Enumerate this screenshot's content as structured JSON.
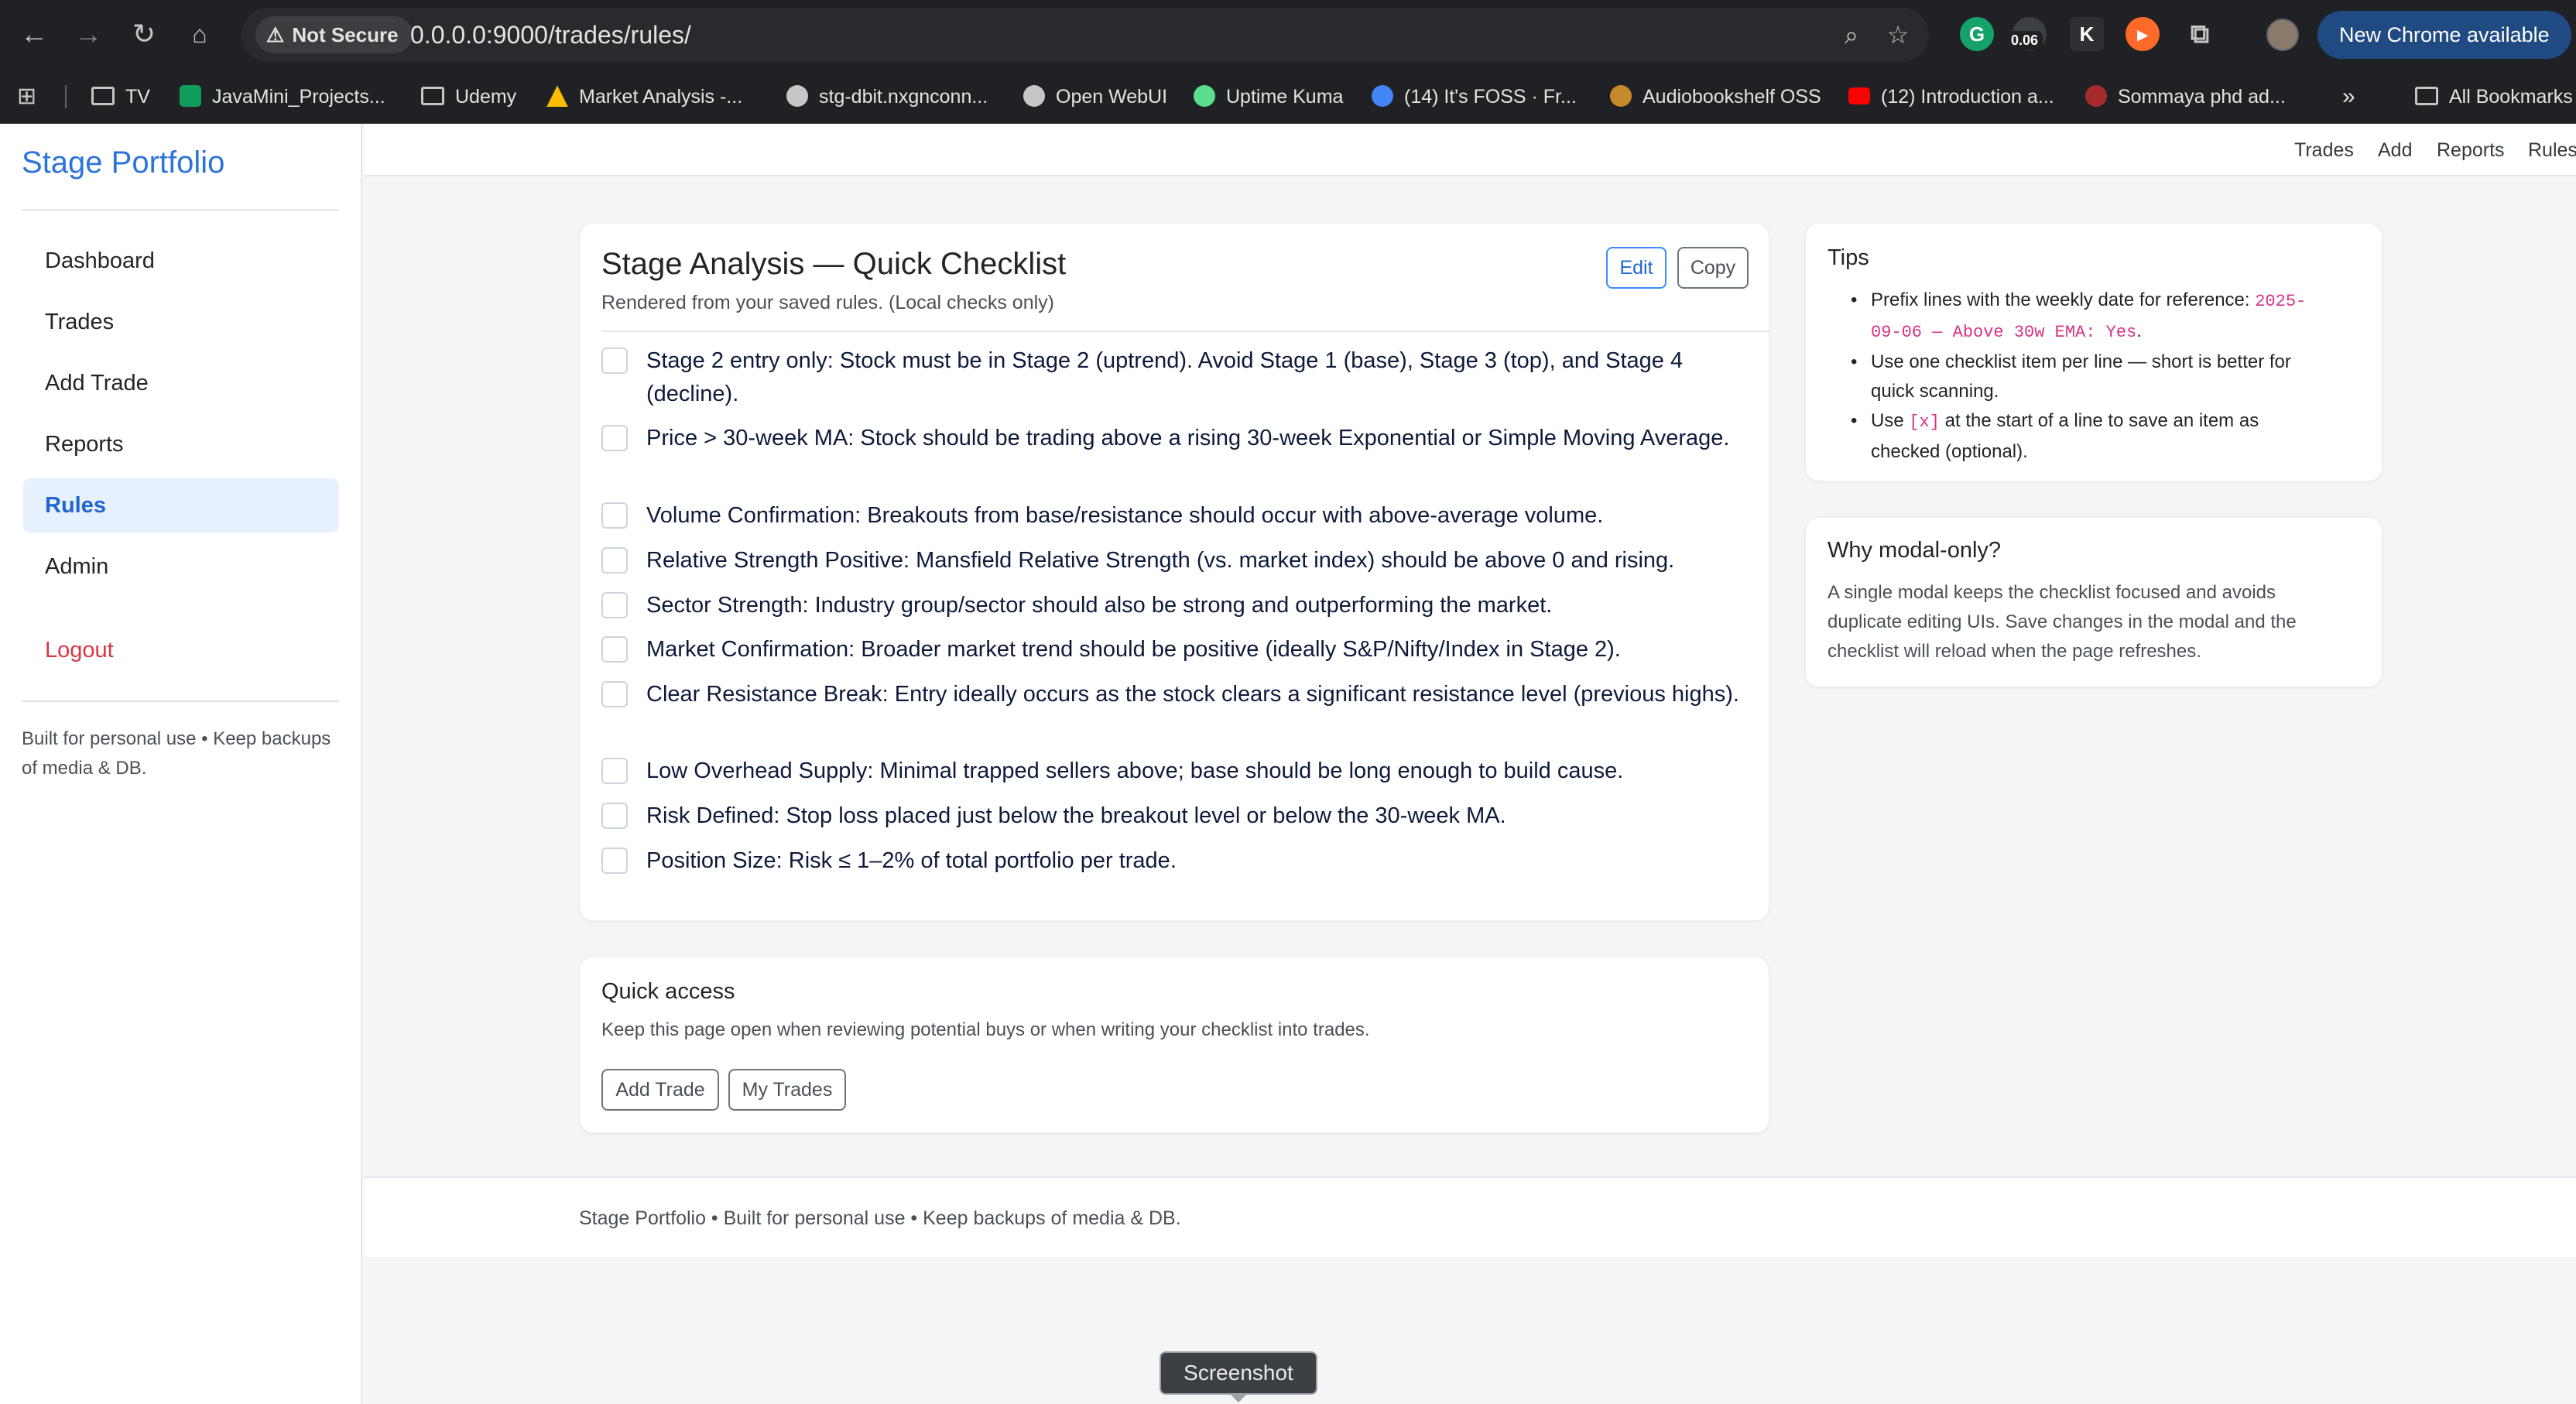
{
  "browser": {
    "not_secure": "Not Secure",
    "warning_icon": "warning-triangle-icon",
    "url": "0.0.0.0:9000/trades/rules/",
    "extension_badge": "0.06",
    "update_button": "New Chrome available",
    "bookmarks": [
      {
        "label": "TV",
        "icon": "folder-icon"
      },
      {
        "label": "JavaMini_Projects...",
        "icon": "sheets-icon",
        "color": "#0f9d58"
      },
      {
        "label": "Udemy",
        "icon": "folder-icon"
      },
      {
        "label": "Market Analysis -...",
        "icon": "drive-icon",
        "color": "#fbbc04"
      },
      {
        "label": "stg-dbit.nxgnconn...",
        "icon": "globe-icon",
        "color": "#c4c7c5"
      },
      {
        "label": "Open WebUI",
        "icon": "globe-icon",
        "color": "#c4c7c5"
      },
      {
        "label": "Uptime Kuma",
        "icon": "uptime-icon",
        "color": "#5cdd8b"
      },
      {
        "label": "(14) It's FOSS · Fr...",
        "icon": "foss-icon",
        "color": "#4285f4"
      },
      {
        "label": "Audiobookshelf OSS",
        "icon": "audiobook-icon",
        "color": "#c58a2c"
      },
      {
        "label": "(12) Introduction a...",
        "icon": "youtube-icon",
        "color": "#ff0000"
      },
      {
        "label": "Sommaya phd ad...",
        "icon": "site-icon",
        "color": "#a52a2a"
      },
      {
        "label": "All Bookmarks",
        "icon": "folder-icon"
      }
    ]
  },
  "sidebar": {
    "brand": "Stage Portfolio",
    "items": [
      {
        "label": "Dashboard"
      },
      {
        "label": "Trades"
      },
      {
        "label": "Add Trade"
      },
      {
        "label": "Reports"
      },
      {
        "label": "Rules"
      },
      {
        "label": "Admin"
      }
    ],
    "logout": "Logout",
    "note": "Built for personal use • Keep backups of media & DB."
  },
  "topnav": [
    "Trades",
    "Add",
    "Reports",
    "Rules"
  ],
  "checklist": {
    "title": "Stage Analysis — Quick Checklist",
    "subtitle": "Rendered from your saved rules. (Local checks only)",
    "edit": "Edit",
    "copy": "Copy",
    "items": [
      {
        "text": "Stage 2 entry only: Stock must be in Stage 2 (uptrend). Avoid Stage 1 (base), Stage 3 (top), and Stage 4 (decline).",
        "checked": false
      },
      {
        "text": "Price > 30-week MA: Stock should be trading above a rising 30-week Exponential or Simple Moving Average.",
        "checked": false
      },
      {
        "text": "Volume Confirmation: Breakouts from base/resistance should occur with above-average volume.",
        "checked": false
      },
      {
        "text": "Relative Strength Positive: Mansfield Relative Strength (vs. market index) should be above 0 and rising.",
        "checked": false
      },
      {
        "text": "Sector Strength: Industry group/sector should also be strong and outperforming the market.",
        "checked": false
      },
      {
        "text": "Market Confirmation: Broader market trend should be positive (ideally S&P/Nifty/Index in Stage 2).",
        "checked": false
      },
      {
        "text": "Clear Resistance Break: Entry ideally occurs as the stock clears a significant resistance level (previous highs).",
        "checked": false
      },
      {
        "text": "Low Overhead Supply: Minimal trapped sellers above; base should be long enough to build cause.",
        "checked": false
      },
      {
        "text": "Risk Defined: Stop loss placed just below the breakout level or below the 30-week MA.",
        "checked": false
      },
      {
        "text": "Position Size: Risk ≤ 1–2% of total portfolio per trade.",
        "checked": false
      }
    ]
  },
  "quick_access": {
    "title": "Quick access",
    "desc": "Keep this page open when reviewing potential buys or when writing your checklist into trades.",
    "add_trade": "Add Trade",
    "my_trades": "My Trades"
  },
  "tips": {
    "title": "Tips",
    "t1_prefix": "Prefix lines with the weekly date for reference: ",
    "t1_code": "2025-09-06 — Above 30w EMA: Yes",
    "t1_suffix": ".",
    "t2": "Use one checklist item per line — short is better for quick scanning.",
    "t3_prefix": "Use ",
    "t3_code": "[x]",
    "t3_suffix": " at the start of a line to save an item as checked (optional)."
  },
  "why": {
    "title": "Why modal-only?",
    "desc": "A single modal keeps the checklist focused and avoids duplicate editing UIs. Save changes in the modal and the checklist will reload when the page refreshes."
  },
  "footer": "Stage Portfolio • Built for personal use • Keep backups of media & DB.",
  "tooltip": "Screenshot",
  "colors": {
    "brand": "#2c74dc",
    "active_bg": "#e7f1fd",
    "danger": "#dc3545",
    "code": "#d63384"
  }
}
